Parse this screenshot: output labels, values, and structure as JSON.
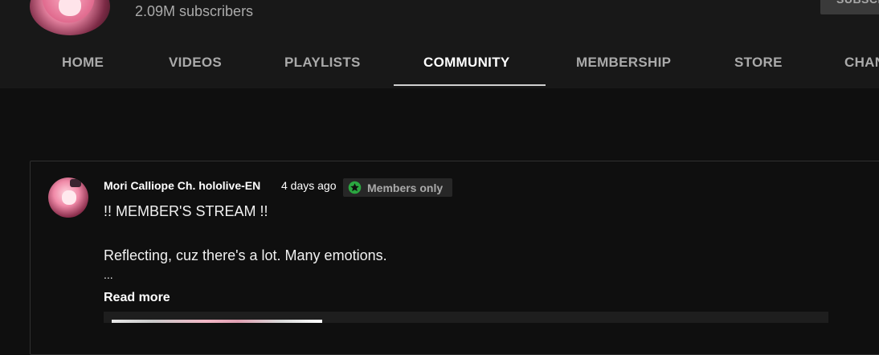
{
  "channel": {
    "subscribers": "2.09M subscribers",
    "subscribe_label": "SUBSCRIBE"
  },
  "tabs": [
    {
      "label": "HOME"
    },
    {
      "label": "VIDEOS"
    },
    {
      "label": "PLAYLISTS"
    },
    {
      "label": "COMMUNITY",
      "active": true
    },
    {
      "label": "MEMBERSHIP"
    },
    {
      "label": "STORE"
    },
    {
      "label": "CHANNELS"
    }
  ],
  "post": {
    "author": "Mori Calliope Ch. hololive-EN",
    "time": "4 days ago",
    "badge": "Members only",
    "lines": [
      "!! MEMBER'S STREAM !!",
      "Reflecting, cuz there's a lot. Many emotions.",
      "..."
    ],
    "read_more": "Read more"
  },
  "colors": {
    "background": "#0f0f0f",
    "header": "#181818",
    "badge_star": "#2ba640"
  }
}
